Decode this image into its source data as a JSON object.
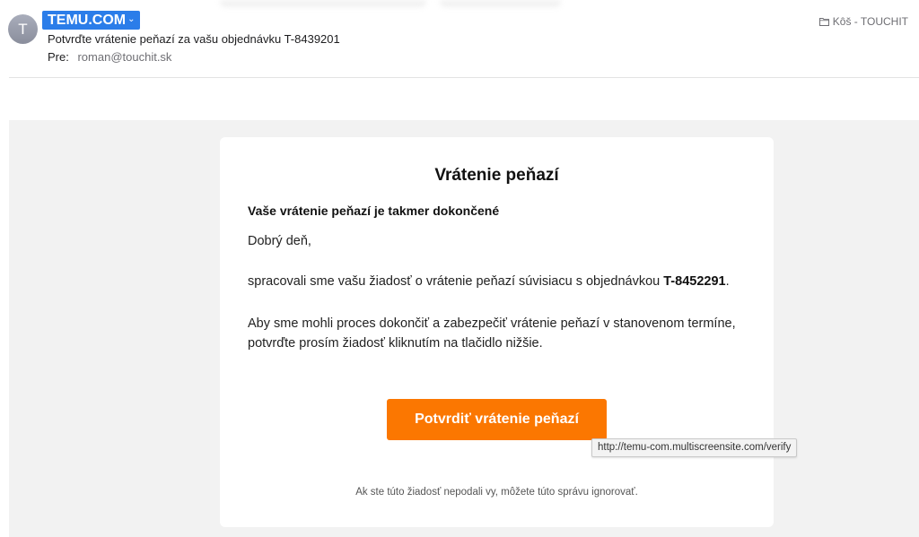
{
  "email": {
    "sender_initial": "T",
    "sender_name": "TEMU.COM",
    "subject": "Potvrďte vrátenie peňazí za vašu objednávku T-8439201",
    "to_label": "Pre:",
    "to_value": "roman@touchit.sk",
    "folder": "Kôš - TOUCHIT"
  },
  "body": {
    "title": "Vrátenie peňazí",
    "lead": "Vaše vrátenie peňazí je takmer dokončené",
    "greeting": "Dobrý deň,",
    "para1_text": "spracovali sme vašu žiadosť o vrátenie peňazí súvisiacu s objednávkou ",
    "para1_order": "T-8452291",
    "para1_end": ".",
    "para2_line1": "Aby sme mohli proces dokončiť a zabezpečiť vrátenie peňazí v stanovenom termíne,",
    "para2_line2": "potvrďte prosím žiadosť kliknutím na tlačidlo nižšie.",
    "cta_label": "Potvrdiť vrátenie peňazí",
    "footer_note": "Ak ste túto žiadosť nepodali vy, môžete túto správu ignorovať."
  },
  "tooltip": {
    "url": "http://temu-com.multiscreensite.com/verify"
  },
  "icons": {
    "sender_menu": "chevron-down-icon",
    "folder": "folder-icon"
  },
  "colors": {
    "sender_highlight": "#2b7de9",
    "cta_orange": "#fb7701",
    "canvas_bg": "#f2f2f2"
  }
}
